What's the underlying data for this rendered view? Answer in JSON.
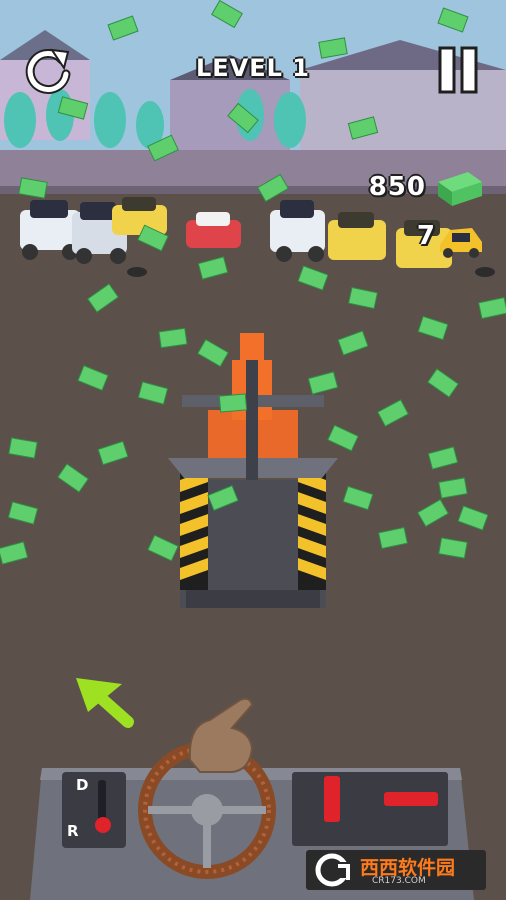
{
  "hud": {
    "level_label": "LEVEL 1",
    "money": "850",
    "cars_count": "7"
  },
  "controls": {
    "gear_drive": "D",
    "gear_reverse": "R"
  },
  "watermark": {
    "text": "西西软件园",
    "sub": "CR173.COM"
  },
  "icons": {
    "restart": "restart-icon",
    "pause": "pause-icon",
    "cash": "cash-stack-icon",
    "car": "car-icon",
    "arrow": "direction-arrow-icon",
    "hand": "pointer-hand-icon"
  },
  "colors": {
    "ground": "#5c504b",
    "cash_green": "#5fcf6e",
    "crusher_orange": "#f2702a",
    "hud_text": "#ffffff"
  }
}
